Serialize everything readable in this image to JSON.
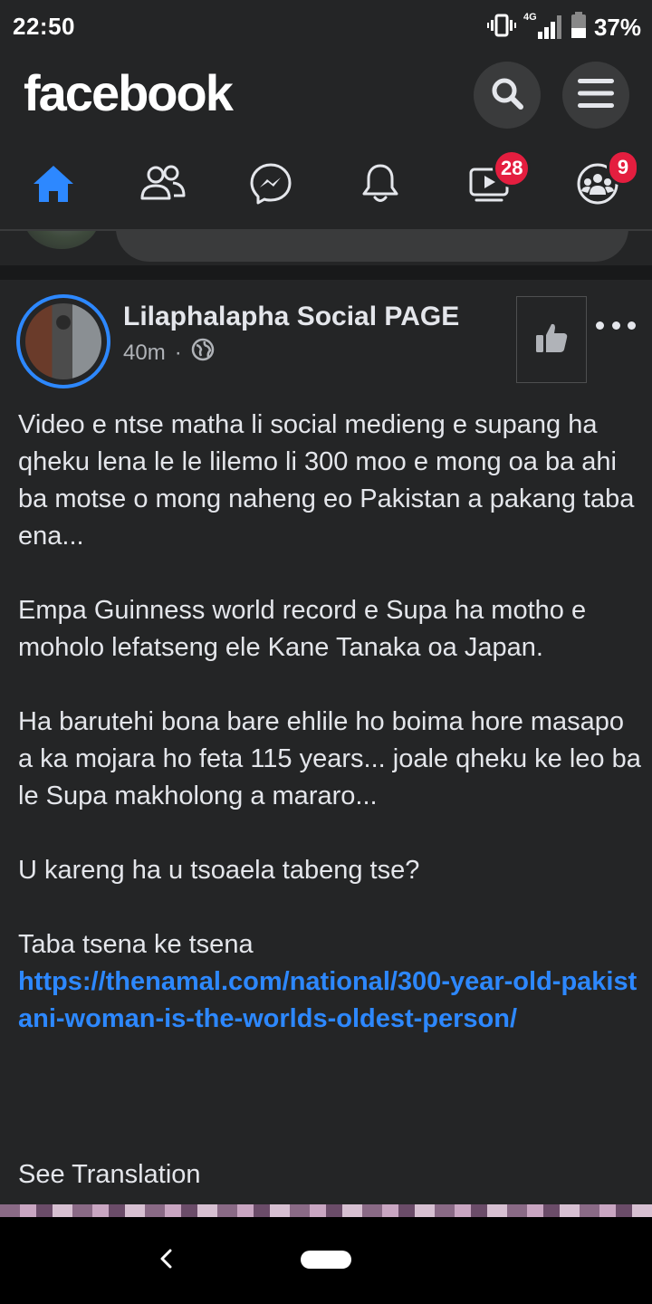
{
  "status_bar": {
    "time": "22:50",
    "network": "4G",
    "battery": "37%"
  },
  "header": {
    "logo": "facebook",
    "search_icon": "search-icon",
    "menu_icon": "menu-icon"
  },
  "tabs": {
    "home": {
      "icon": "home-icon",
      "active": true
    },
    "friends": {
      "icon": "friends-icon"
    },
    "messenger": {
      "icon": "messenger-icon"
    },
    "notifications": {
      "icon": "bell-icon"
    },
    "watch": {
      "icon": "watch-icon",
      "badge": "28"
    },
    "groups": {
      "icon": "groups-icon",
      "badge": "9"
    }
  },
  "post": {
    "page_name": "Lilaphalapha Social PAGE",
    "time": "40m",
    "separator": "·",
    "audience_icon": "globe-icon",
    "paragraphs": [
      "Video e ntse matha li social medieng e supang ha qheku lena le le lilemo li 300 moo e mong oa ba ahi ba motse o mong naheng eo Pakistan a pakang taba ena...",
      "Empa Guinness world record e Supa ha motho e moholo lefatseng ele Kane Tanaka oa Japan.",
      "Ha barutehi bona bare ehlile ho boima hore masapo a ka mojara ho feta 115 years... joale qheku ke leo ba le Supa makholong a mararo...",
      "U kareng ha u tsoaela tabeng tse?"
    ],
    "closing_line": "Taba tsena ke tsena",
    "link": "https://thenamal.com/national/300-year-old-pakistani-woman-is-the-worlds-oldest-person/",
    "see_translation": "See Translation"
  },
  "colors": {
    "background": "#242526",
    "accent": "#2d88ff",
    "badge": "#e41e3f",
    "text": "#e4e6eb",
    "muted": "#b0b3b8"
  }
}
